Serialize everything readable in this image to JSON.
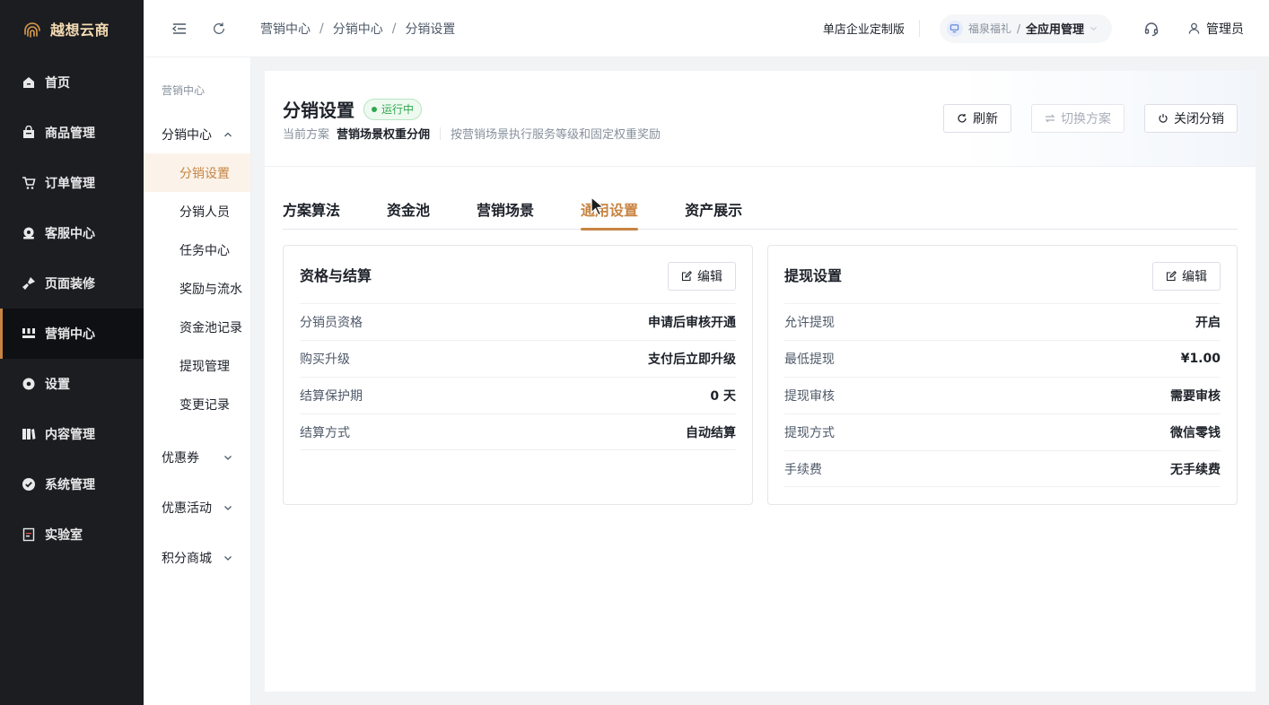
{
  "app": {
    "name": "越想云商"
  },
  "sidebar": {
    "items": [
      {
        "label": "首页",
        "icon": "home-icon"
      },
      {
        "label": "商品管理",
        "icon": "shop-icon"
      },
      {
        "label": "订单管理",
        "icon": "cart-icon"
      },
      {
        "label": "客服中心",
        "icon": "support-icon"
      },
      {
        "label": "页面装修",
        "icon": "brush-icon"
      },
      {
        "label": "营销中心",
        "icon": "marketing-icon",
        "active": true
      },
      {
        "label": "设置",
        "icon": "gear-icon"
      },
      {
        "label": "内容管理",
        "icon": "content-icon"
      },
      {
        "label": "系统管理",
        "icon": "system-icon"
      },
      {
        "label": "实验室",
        "icon": "lab-icon"
      }
    ]
  },
  "submenu": {
    "header": "营销中心",
    "group": "分销中心",
    "items": [
      "分销设置",
      "分销人员",
      "任务中心",
      "奖励与流水",
      "资金池记录",
      "提现管理",
      "变更记录"
    ],
    "active": "分销设置",
    "collapsed": [
      "优惠券",
      "优惠活动",
      "积分商城"
    ]
  },
  "topbar": {
    "breadcrumb": [
      "营销中心",
      "分销中心",
      "分销设置"
    ],
    "edition": "单店企业定制版",
    "org": "福泉福礼",
    "app": "全应用管理",
    "user": "管理员"
  },
  "page": {
    "title": "分销设置",
    "status": "运行中",
    "plan_label": "当前方案",
    "plan_value": "营销场景权重分佣",
    "plan_desc": "按营销场景执行服务等级和固定权重奖励",
    "buttons": {
      "refresh": "刷新",
      "switch": "切换方案",
      "close": "关闭分销"
    },
    "tabs": [
      "方案算法",
      "资金池",
      "营销场景",
      "通用设置",
      "资产展示"
    ],
    "active_tab": "通用设置"
  },
  "panels": {
    "left": {
      "title": "资格与结算",
      "edit": "编辑",
      "rows": [
        {
          "k": "分销员资格",
          "v": "申请后审核开通"
        },
        {
          "k": "购买升级",
          "v": "支付后立即升级"
        },
        {
          "k": "结算保护期",
          "v": "0 天"
        },
        {
          "k": "结算方式",
          "v": "自动结算"
        }
      ]
    },
    "right": {
      "title": "提现设置",
      "edit": "编辑",
      "rows": [
        {
          "k": "允许提现",
          "v": "开启"
        },
        {
          "k": "最低提现",
          "v": "¥1.00"
        },
        {
          "k": "提现审核",
          "v": "需要审核"
        },
        {
          "k": "提现方式",
          "v": "微信零钱"
        },
        {
          "k": "手续费",
          "v": "无手续费"
        }
      ]
    }
  },
  "colors": {
    "accent": "#c78442",
    "sidebar_bg": "#1c1d21",
    "success": "#2fa84f"
  }
}
